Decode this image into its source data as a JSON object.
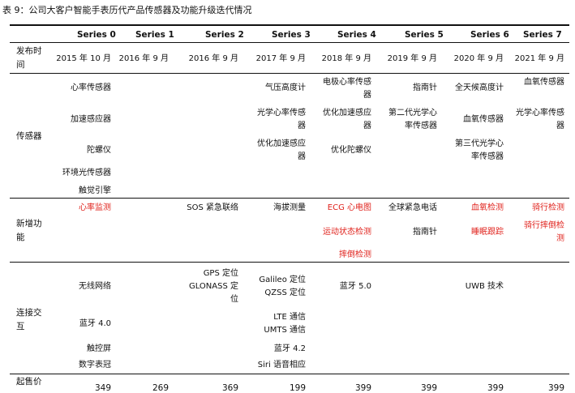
{
  "title": "表 9：公司大客户智能手表历代产品传感器及功能升级迭代情况",
  "series": [
    "Series 0",
    "Series 1",
    "Series 2",
    "Series 3",
    "Series 4",
    "Series 5",
    "Series 6",
    "Series 7"
  ],
  "labels": {
    "release": [
      "发布时",
      "间"
    ],
    "sensor": "传感器",
    "feature": [
      "新增功",
      "能"
    ],
    "connect": [
      "连接交",
      "互"
    ],
    "price": "起售价"
  },
  "release_dates": [
    "2015 年 10 月",
    "2016 年 9 月",
    "2016 年 9 月",
    "2017 年 9 月",
    "2018 年 9 月",
    "2019 年 9 月",
    "2020 年 9 月",
    "2021 年 9 月"
  ],
  "sensors": {
    "s0": [
      "心率传感器",
      "加速感应器",
      "陀螺仪",
      "环境光传感器",
      "触觉引擎"
    ],
    "s3": [
      "气压高度计",
      "光学心率传感",
      "器",
      "优化加速感应",
      "器"
    ],
    "s4": [
      "电极心率传感",
      "器",
      "优化加速感应",
      "器",
      "优化陀螺仪"
    ],
    "s5": [
      "指南针",
      "第二代光学心",
      "率传感器"
    ],
    "s6": [
      "全天候高度计",
      "血氧传感器",
      "第三代光学心",
      "率传感器"
    ],
    "s7": [
      "血氧传感器",
      "光学心率传感",
      "器"
    ]
  },
  "features": {
    "s0": [
      "心率监测"
    ],
    "s2": [
      "SOS 紧急联络"
    ],
    "s3": [
      "海拔测量"
    ],
    "s4": [
      "ECG 心电图",
      "运动状态检测",
      "摔倒检测"
    ],
    "s5": [
      "全球紧急电话",
      "指南针"
    ],
    "s6": [
      "血氧检测",
      "睡眠跟踪"
    ],
    "s7": [
      "骑行检测",
      "骑行摔倒检",
      "测"
    ]
  },
  "connect": {
    "s0": [
      "无线网络",
      "蓝牙 4.0",
      "触控屏",
      "数字表冠"
    ],
    "s2": [
      "GPS 定位",
      "GLONASS 定",
      "位"
    ],
    "s3": [
      "Galileo 定位",
      "QZSS 定位",
      "LTE 通信",
      "UMTS 通信",
      "蓝牙 4.2",
      "Siri 语音相应"
    ],
    "s4": [
      "蓝牙 5.0"
    ],
    "s6": [
      "UWB 技术"
    ]
  },
  "prices": [
    "349",
    "269",
    "369",
    "199",
    "399",
    "399",
    "399",
    "399"
  ],
  "colors": {
    "highlight": "#e0231d",
    "text": "#111111"
  }
}
